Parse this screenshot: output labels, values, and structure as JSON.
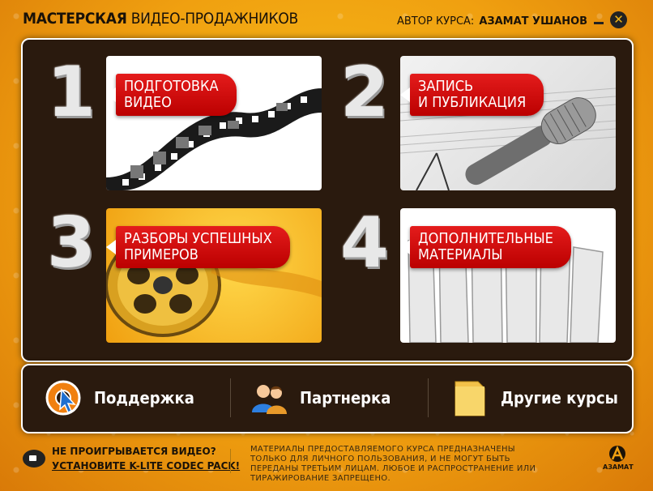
{
  "header": {
    "title_bold": "МАСТЕРСКАЯ",
    "title_rest": "ВИДЕО-ПРОДАЖНИКОВ",
    "author_label": "АВТОР КУРСА:",
    "author_name": "АЗАМАТ УШАНОВ",
    "close_glyph": "✕"
  },
  "sections": [
    {
      "number": "1",
      "line1": "ПОДГОТОВКА",
      "line2": "ВИДЕО"
    },
    {
      "number": "2",
      "line1": "ЗАПИСЬ",
      "line2": "И ПУБЛИКАЦИЯ"
    },
    {
      "number": "3",
      "line1": "РАЗБОРЫ УСПЕШНЫХ",
      "line2": "ПРИМЕРОВ"
    },
    {
      "number": "4",
      "line1": "ДОПОЛНИТЕЛЬНЫЕ",
      "line2": "МАТЕРИАЛЫ"
    }
  ],
  "bottom_bar": {
    "support": "Поддержка",
    "partner": "Партнерка",
    "courses": "Другие курсы"
  },
  "footer": {
    "question": "НЕ ПРОИГРЫВАЕТСЯ ВИДЕО?",
    "link": "УСТАНОВИТЕ K-LITE CODEC PACK!",
    "legal": "МАТЕРИАЛЫ ПРЕДОСТАВЛЯЕМОГО КУРСА ПРЕДНАЗНАЧЕНЫ ТОЛЬКО ДЛЯ ЛИЧНОГО ПОЛЬЗОВАНИЯ, И НЕ МОГУТ БЫТЬ ПЕРЕДАНЫ ТРЕТЬИМ ЛИЦАМ. ЛЮБОЕ И РАСПРОСТРАНЕНИЕ ИЛИ ТИРАЖИРОВАНИЕ ЗАПРЕЩЕНО.",
    "logo_text": "АЗАМАТ"
  },
  "colors": {
    "accent_red": "#d61414",
    "background_yellow": "#f0a010",
    "panel_dark": "#2a1a0e"
  },
  "icons": [
    "film-strip-icon",
    "microphone-icon",
    "film-reel-icon",
    "folders-icon",
    "support-lifebuoy-icon",
    "partners-icon",
    "folder-icon",
    "video-camera-icon",
    "azamat-logo-icon",
    "close-icon",
    "minimize-icon"
  ]
}
